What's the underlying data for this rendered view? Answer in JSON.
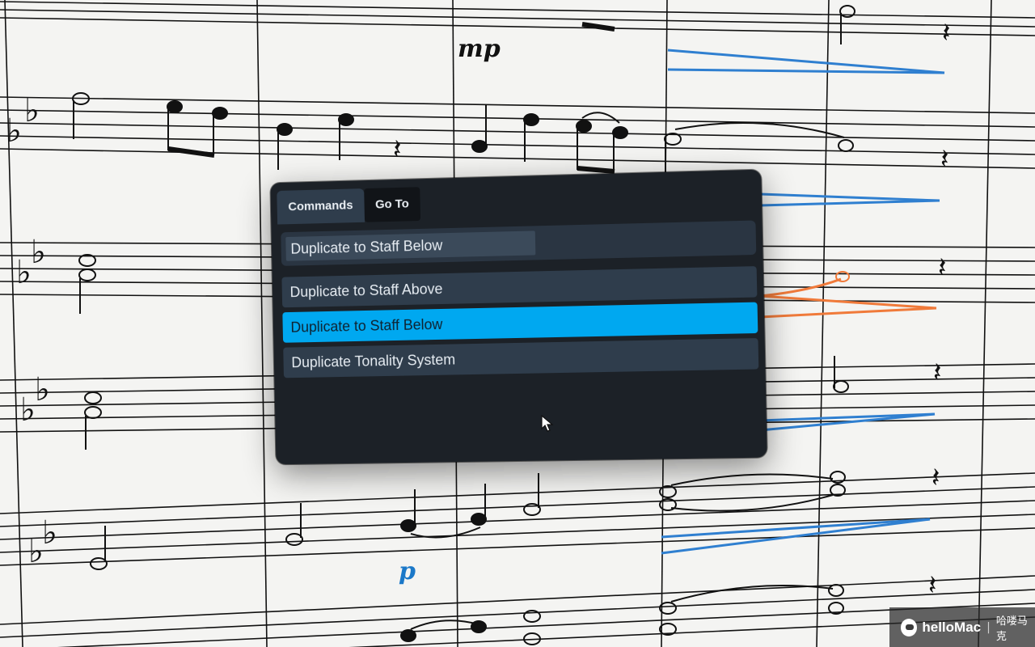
{
  "score": {
    "dynamics": [
      "mp",
      "p"
    ]
  },
  "palette": {
    "tabs": [
      {
        "label": "Commands",
        "active": true
      },
      {
        "label": "Go To",
        "active": false
      }
    ],
    "search": {
      "value": "Duplicate to Staff Below",
      "placeholder": ""
    },
    "results": [
      {
        "label": "Duplicate to Staff Above",
        "selected": false
      },
      {
        "label": "Duplicate to Staff Below",
        "selected": true
      },
      {
        "label": "Duplicate Tonality System",
        "selected": false
      }
    ]
  },
  "watermark": {
    "brand": "helloMac",
    "separator": "|",
    "chinese": "哈喽马克"
  },
  "colors": {
    "accent_selected": "#00a8f0",
    "panel_bg": "#1c2127",
    "row_bg": "#2f3d4c",
    "hairpin_blue": "#2f7fd0",
    "hairpin_orange": "#f07a3a"
  }
}
